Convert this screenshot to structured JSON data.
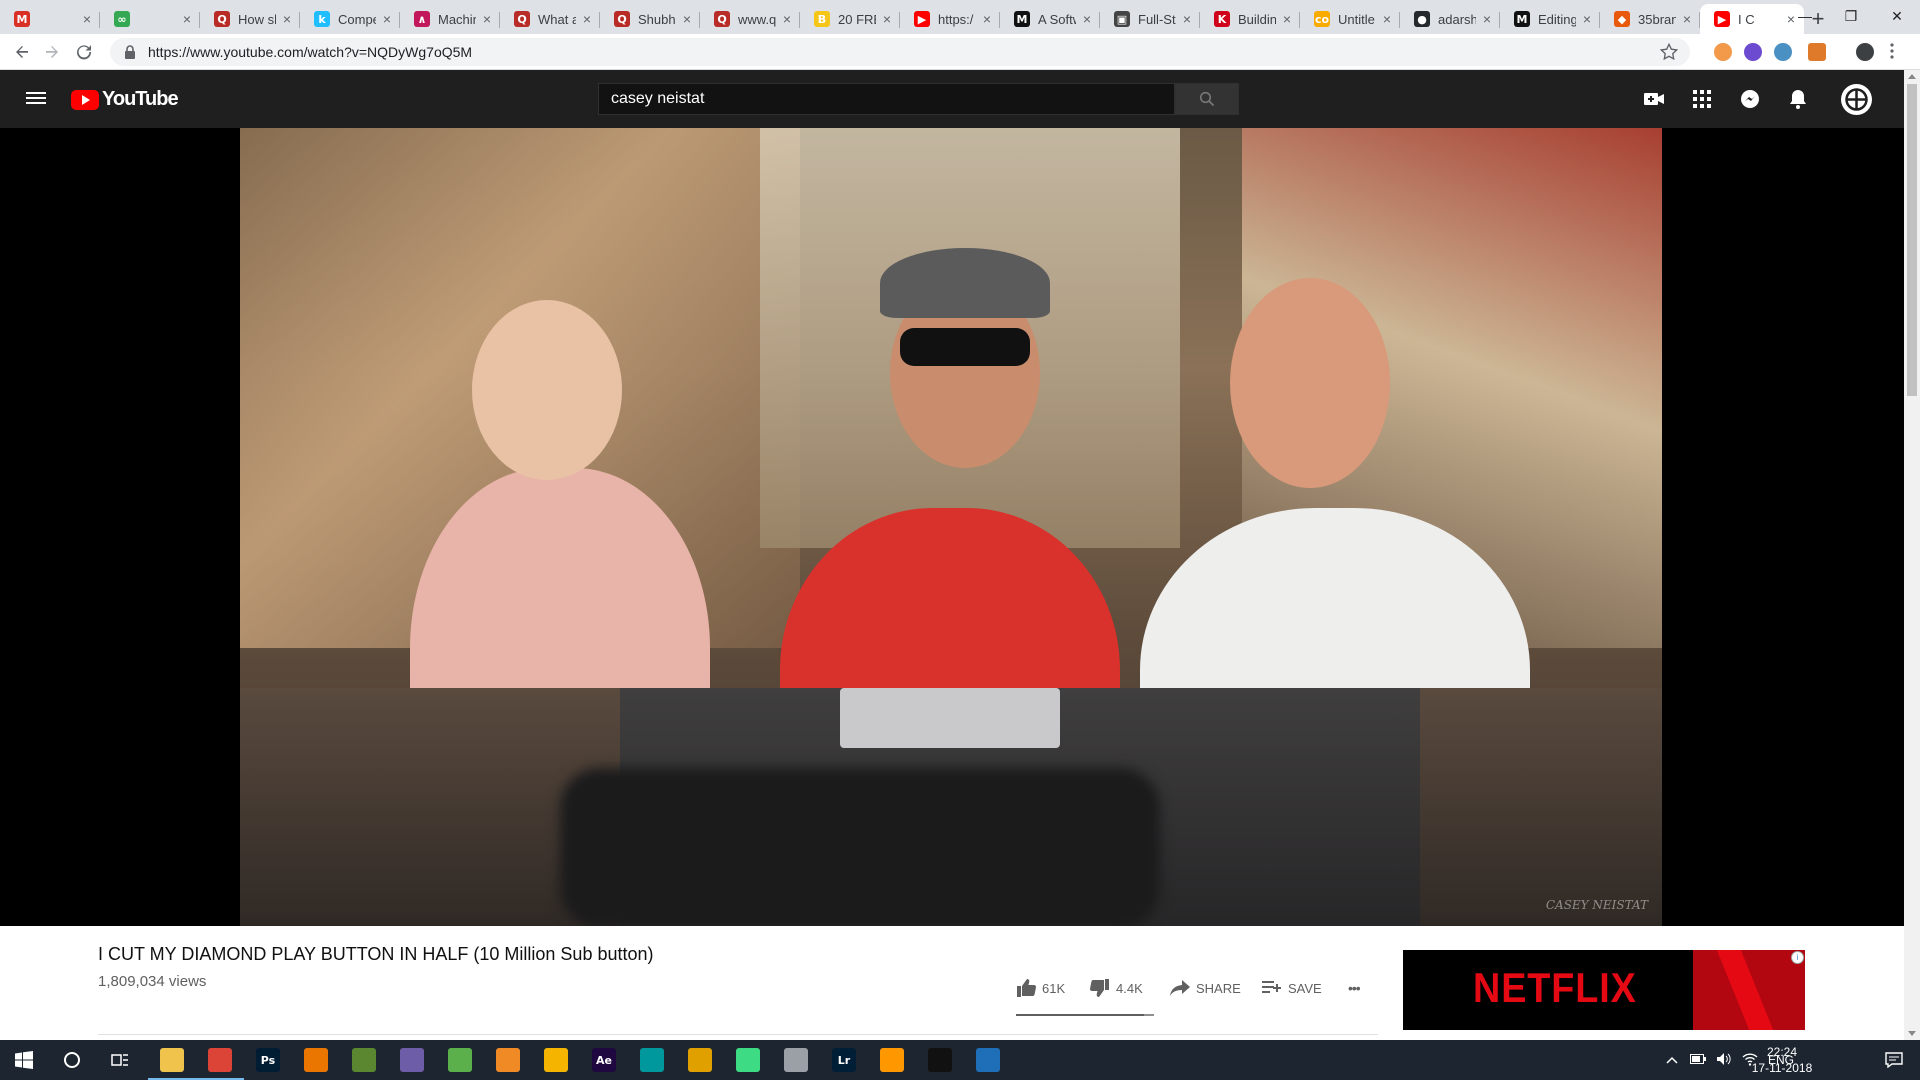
{
  "browser": {
    "tabs": [
      {
        "title": "",
        "favicon": "gmail-icon",
        "color": "#d93025"
      },
      {
        "title": "",
        "favicon": "link-icon",
        "color": "#34a853"
      },
      {
        "title": "How sh",
        "favicon": "quora-icon",
        "color": "#b92b27"
      },
      {
        "title": "Compe",
        "favicon": "kaggle-icon",
        "color": "#20beff"
      },
      {
        "title": "Machin",
        "favicon": "coursera-icon",
        "color": "#c2185b"
      },
      {
        "title": "What a",
        "favicon": "quora-icon",
        "color": "#b92b27"
      },
      {
        "title": "Shubh",
        "favicon": "quora-icon",
        "color": "#b92b27"
      },
      {
        "title": "www.q",
        "favicon": "quora-icon",
        "color": "#b92b27"
      },
      {
        "title": "20 FRE",
        "favicon": "bookmark-icon",
        "color": "#f5c518"
      },
      {
        "title": "https:/",
        "favicon": "youtube-icon",
        "color": "#ff0000"
      },
      {
        "title": "A Softw",
        "favicon": "medium-icon",
        "color": "#111111"
      },
      {
        "title": "Full-St",
        "favicon": "app-icon",
        "color": "#444444"
      },
      {
        "title": "Buildin",
        "favicon": "k-icon",
        "color": "#d0021b"
      },
      {
        "title": "Untitle",
        "favicon": "colab-icon",
        "color": "#f9ab00"
      },
      {
        "title": "adarsh",
        "favicon": "github-icon",
        "color": "#24292e"
      },
      {
        "title": "Editing",
        "favicon": "medium-icon",
        "color": "#111111"
      },
      {
        "title": "35bran",
        "favicon": "fox-icon",
        "color": "#e8590c"
      },
      {
        "title": "I C",
        "favicon": "youtube-icon",
        "color": "#ff0000",
        "active": true
      }
    ],
    "favicon_letters": [
      "M",
      "∞",
      "Q",
      "k",
      "∧",
      "Q",
      "Q",
      "Q",
      "B",
      "▶",
      "M",
      "▣",
      "K",
      "co",
      "●",
      "M",
      "◆",
      "▶"
    ],
    "tab_close": "×",
    "new_tab": "+",
    "window_controls": {
      "minimize": "—",
      "maximize": "❐",
      "close": "✕"
    },
    "url": "https://www.youtube.com/watch?v=NQDyWg7oQ5M"
  },
  "youtube": {
    "logo_text": "YouTube",
    "search_value": "casey neistat",
    "video": {
      "title": "I CUT MY DIAMOND PLAY BUTTON IN HALF (10 Million Sub button)",
      "views": "1,809,034 views",
      "likes": "61K",
      "dislikes": "4.4K",
      "share_label": "SHARE",
      "save_label": "SAVE",
      "more_label": "•••",
      "watermark": "CASEY NEISTAT",
      "like_ratio": 0.93
    },
    "ad": {
      "brand": "NETFLIX",
      "badge": "i"
    }
  },
  "taskbar": {
    "apps": [
      {
        "name": "file-explorer",
        "letter": "",
        "color": "#f0c44c"
      },
      {
        "name": "chrome",
        "letter": "",
        "color": "#db4437"
      },
      {
        "name": "photoshop",
        "letter": "Ps",
        "color": "#001d34"
      },
      {
        "name": "blender",
        "letter": "",
        "color": "#ea7600"
      },
      {
        "name": "minecraft",
        "letter": "",
        "color": "#5b8731"
      },
      {
        "name": "app-disc",
        "letter": "",
        "color": "#6d5da8"
      },
      {
        "name": "notepad",
        "letter": "",
        "color": "#5bb04b"
      },
      {
        "name": "fl-studio",
        "letter": "",
        "color": "#f08a24"
      },
      {
        "name": "app-fire",
        "letter": "",
        "color": "#f4b400"
      },
      {
        "name": "after-effects",
        "letter": "Ae",
        "color": "#1f0740"
      },
      {
        "name": "arduino",
        "letter": "",
        "color": "#00979d"
      },
      {
        "name": "app-lion",
        "letter": "",
        "color": "#e0a100"
      },
      {
        "name": "android-studio",
        "letter": "",
        "color": "#3ddc84"
      },
      {
        "name": "app-robot",
        "letter": "",
        "color": "#9aa0a6"
      },
      {
        "name": "lightroom",
        "letter": "Lr",
        "color": "#001e36"
      },
      {
        "name": "sublime-text",
        "letter": "",
        "color": "#ff9800"
      },
      {
        "name": "terminal",
        "letter": "",
        "color": "#111111"
      },
      {
        "name": "vscode",
        "letter": "",
        "color": "#1e6fb8"
      }
    ],
    "tray_language": "ENG",
    "time": "22:24",
    "date": "17-11-2018"
  },
  "colors": {
    "youtube_red": "#ff0000",
    "header_bg": "#1f1f1f",
    "taskbar_bg": "#1c2530",
    "netflix_red": "#e50914"
  }
}
